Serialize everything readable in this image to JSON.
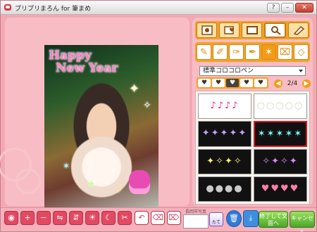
{
  "window": {
    "title": "プリプリまろん for 筆まめ",
    "help_label": "?",
    "min_label": "–",
    "close_label": "✕"
  },
  "photo": {
    "title_line1": "Happy",
    "title_line2": "New Year"
  },
  "panel": {
    "category_tabs": [
      {
        "icon": "frame-icon"
      },
      {
        "icon": "heart-card-icon"
      },
      {
        "icon": "rectangle-icon"
      },
      {
        "icon": "magic-brush-icon"
      },
      {
        "icon": "eraser-icon"
      }
    ],
    "tools": [
      {
        "icon": "pencil-icon",
        "glyph": "✎"
      },
      {
        "icon": "marker-icon",
        "glyph": "✐"
      },
      {
        "icon": "brush-icon",
        "glyph": "✑"
      },
      {
        "icon": "wand-icon",
        "glyph": "✒"
      },
      {
        "icon": "sparkle-stamp-icon",
        "glyph": "✶"
      },
      {
        "icon": "fill-icon",
        "glyph": "⌧"
      },
      {
        "icon": "erase-icon",
        "glyph": "◇"
      }
    ],
    "pen_select": "標準コロコロペン",
    "heart_sizes": [
      "♥",
      "♥",
      "♥",
      "♥",
      "♥"
    ],
    "pager": {
      "prev": "◀",
      "text": "2/4",
      "next": "▶"
    },
    "stamps": [
      {
        "glyph": "♪♪♪♪",
        "style": "light",
        "color": "c-pink"
      },
      {
        "glyph": "○○○○○",
        "style": "light",
        "color": "c-white"
      },
      {
        "glyph": "✦✦✦✦✦",
        "style": "dark",
        "color": "c-purple"
      },
      {
        "glyph": "✶✶✶✶✶",
        "style": "dark",
        "color": "c-cyan"
      },
      {
        "glyph": "✦✧✦✧",
        "style": "dark",
        "color": "c-yellow"
      },
      {
        "glyph": "✧✦✧✦",
        "style": "dark",
        "color": "c-violet"
      },
      {
        "glyph": "●●●●",
        "style": "dark",
        "color": "c-silver"
      },
      {
        "glyph": "♥♥♥♥",
        "style": "dark",
        "color": "c-rose"
      }
    ]
  },
  "toolbar": {
    "buttons": [
      {
        "name": "fit-button",
        "glyph": "◉"
      },
      {
        "name": "zoom-in-button",
        "glyph": "+"
      },
      {
        "name": "zoom-out-button",
        "glyph": "−"
      },
      {
        "name": "flip-horizontal-button",
        "glyph": "⇋"
      },
      {
        "name": "flip-vertical-button",
        "glyph": "⇵"
      },
      {
        "name": "brightness-button",
        "glyph": "☀"
      },
      {
        "name": "night-mode-button",
        "glyph": "☾"
      },
      {
        "name": "cut-button",
        "glyph": "✂"
      },
      {
        "name": "undo-button",
        "glyph": "↶"
      },
      {
        "name": "delete-stamp-button",
        "glyph": "⌫"
      },
      {
        "name": "delete-pen-button",
        "glyph": "⌦"
      }
    ],
    "save_caption": "長岡市写真",
    "tate_label": "たて",
    "trash_glyph": "🗑",
    "save_glyph": "⤓",
    "done_label": "終了して文面へ",
    "cancel_label": "キャンセル"
  }
}
